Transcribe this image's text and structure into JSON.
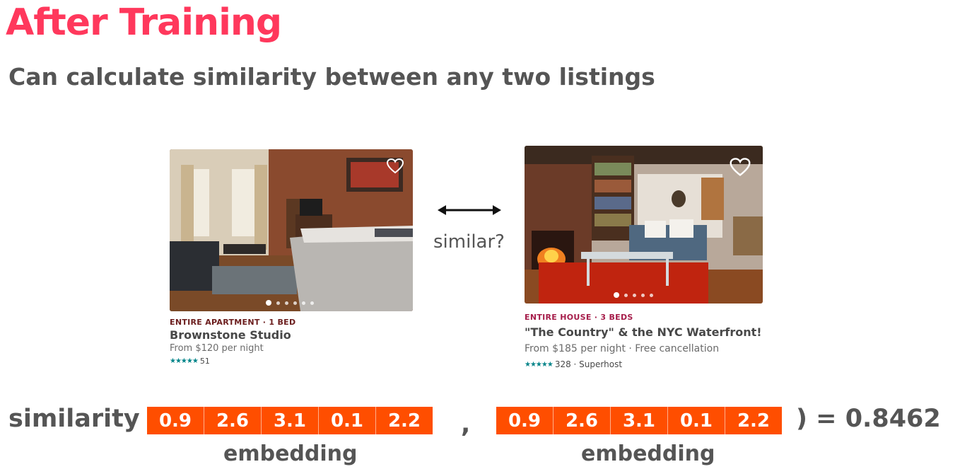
{
  "slide": {
    "title": "After Training",
    "subtitle": "Can calculate similarity between any two listings"
  },
  "colors": {
    "title": "#ff385c",
    "embedding_bg": "#ff4e00",
    "kind_left": "#6b1d1d",
    "kind_right": "#a61d4a",
    "stars": "#008489"
  },
  "listing_left": {
    "kind": "ENTIRE APARTMENT · 1 BED",
    "name": "Brownstone Studio",
    "price": "From $120  per night",
    "stars": "★★★★★",
    "reviews": "51",
    "photo_dots": 6
  },
  "listing_right": {
    "kind": "ENTIRE HOUSE · 3 BEDS",
    "name": "\"The Country\" & the NYC Waterfront!",
    "price": "From $185  per night · Free cancellation",
    "stars": "★★★★★",
    "reviews": "328 · Superhost",
    "photo_dots": 5
  },
  "compare": {
    "label": "similar?",
    "icon": "double-arrow-icon"
  },
  "formula": {
    "prefix": "similarity (",
    "separator": ",",
    "suffix": ") = 0.8462",
    "embedding_a": [
      "0.9",
      "2.6",
      "3.1",
      "0.1",
      "2.2"
    ],
    "embedding_b": [
      "0.9",
      "2.6",
      "3.1",
      "0.1",
      "2.2"
    ],
    "label_a": "embedding",
    "label_b": "embedding"
  }
}
